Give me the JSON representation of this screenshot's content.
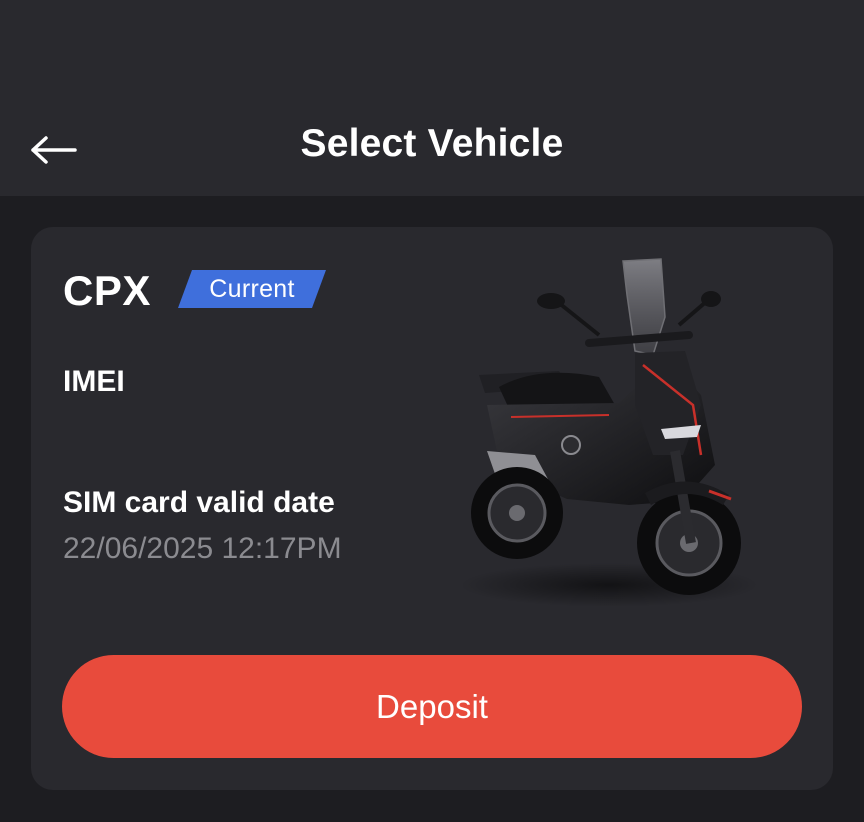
{
  "header": {
    "title": "Select Vehicle",
    "back_icon": "arrow-left-icon"
  },
  "vehicle": {
    "name": "CPX",
    "badge": "Current",
    "imei_label": "IMEI",
    "imei_value": "",
    "sim_label": "SIM card valid date",
    "sim_value": "22/06/2025 12:17PM",
    "image": "scooter-image"
  },
  "actions": {
    "deposit_label": "Deposit"
  },
  "colors": {
    "background": "#1d1d21",
    "header": "#29292e",
    "card": "#29292e",
    "badge": "#3f6fdc",
    "button": "#e84b3c",
    "muted_text": "#8b8b90"
  }
}
